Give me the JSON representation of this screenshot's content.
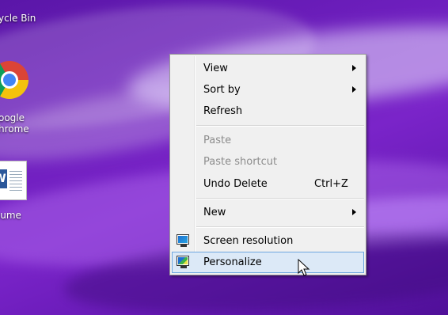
{
  "desktop": {
    "icons": [
      {
        "label": "ycle Bin",
        "icon": "recycle-bin-icon"
      },
      {
        "label": "oogle\nhrome",
        "icon": "chrome-icon"
      },
      {
        "label": "sume",
        "icon": "word-document-icon"
      }
    ]
  },
  "context_menu": {
    "items": [
      {
        "label": "View",
        "submenu": true
      },
      {
        "label": "Sort by",
        "submenu": true
      },
      {
        "label": "Refresh"
      },
      {
        "label": "Paste",
        "disabled": true
      },
      {
        "label": "Paste shortcut",
        "disabled": true
      },
      {
        "label": "Undo Delete",
        "shortcut": "Ctrl+Z"
      },
      {
        "label": "New",
        "submenu": true
      },
      {
        "label": "Screen resolution",
        "icon": "monitor-icon"
      },
      {
        "label": "Personalize",
        "icon": "personalize-icon",
        "highlighted": true
      }
    ]
  },
  "colors": {
    "menu_bg": "#f0f0f0",
    "highlight_bg": "#dce9f7",
    "highlight_border": "#6fa7df",
    "desktop_accent": "#6f1fbf"
  }
}
